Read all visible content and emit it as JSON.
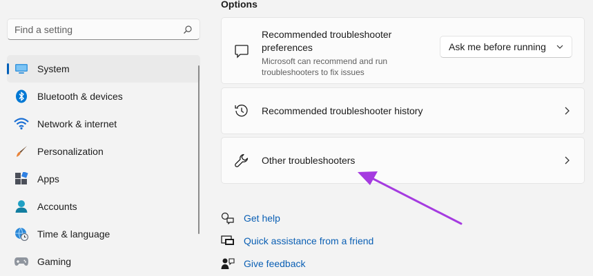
{
  "search": {
    "placeholder": "Find a setting",
    "icon": "search-icon"
  },
  "sidebar": {
    "items": [
      {
        "label": "System",
        "icon": "monitor-icon",
        "selected": true
      },
      {
        "label": "Bluetooth & devices",
        "icon": "bluetooth-icon"
      },
      {
        "label": "Network & internet",
        "icon": "wifi-icon"
      },
      {
        "label": "Personalization",
        "icon": "brush-icon"
      },
      {
        "label": "Apps",
        "icon": "apps-icon"
      },
      {
        "label": "Accounts",
        "icon": "account-icon"
      },
      {
        "label": "Time & language",
        "icon": "globe-clock-icon"
      },
      {
        "label": "Gaming",
        "icon": "gamepad-icon"
      }
    ]
  },
  "main": {
    "section_title": "Options",
    "cards": [
      {
        "title": "Recommended troubleshooter preferences",
        "subtitle": "Microsoft can recommend and run troubleshooters to fix issues",
        "icon": "chat-bubble-icon",
        "dropdown_value": "Ask me before running"
      },
      {
        "title": "Recommended troubleshooter history",
        "icon": "history-icon"
      },
      {
        "title": "Other troubleshooters",
        "icon": "wrench-icon"
      }
    ],
    "links": [
      {
        "label": "Get help",
        "icon": "help-chat-icon"
      },
      {
        "label": "Quick assistance from a friend",
        "icon": "remote-assist-icon"
      },
      {
        "label": "Give feedback",
        "icon": "feedback-icon"
      }
    ]
  },
  "colors": {
    "accent": "#005fb8",
    "link": "#0a5fb4",
    "annotation_arrow": "#a53be0"
  }
}
